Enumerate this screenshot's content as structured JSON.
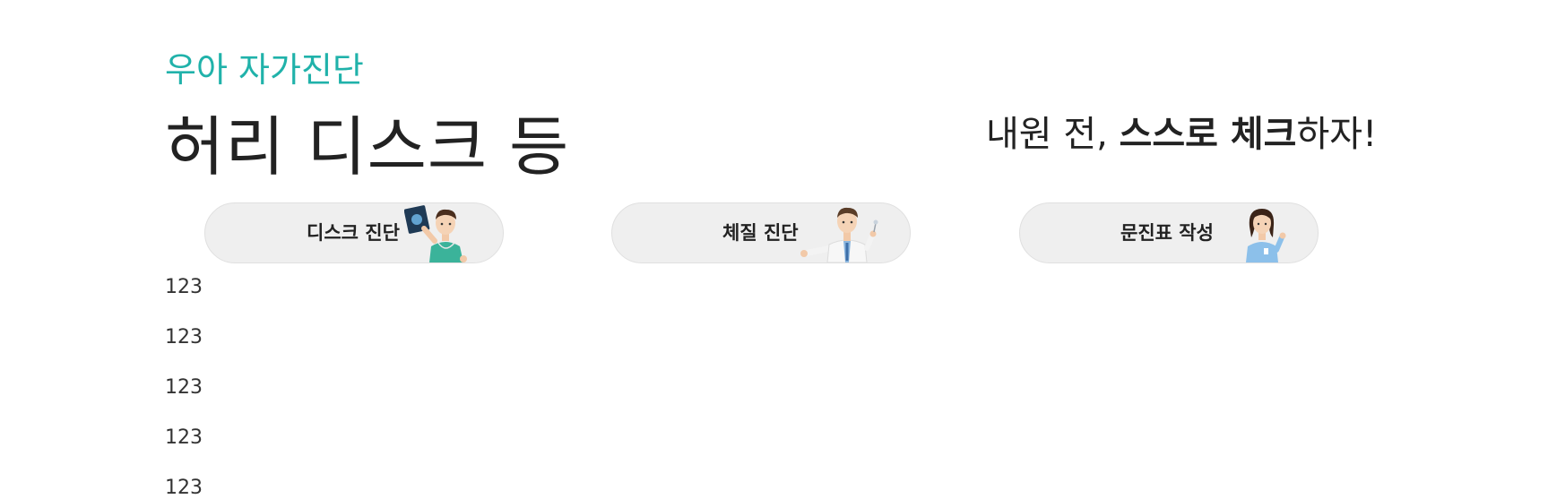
{
  "header": {
    "subtitle": "우아 자가진단",
    "title": "허리 디스크 등",
    "tagline": {
      "part1": "내원 전, ",
      "part2_bold": "스스로 체크",
      "part3": "하자!"
    }
  },
  "buttons": [
    {
      "label": "디스크 진단",
      "icon": "doctor-holding-xray-icon"
    },
    {
      "label": "체질 진단",
      "icon": "doctor-presenting-icon"
    },
    {
      "label": "문진표 작성",
      "icon": "nurse-pointing-icon"
    }
  ],
  "list": [
    "123",
    "123",
    "123",
    "123",
    "123"
  ],
  "colors": {
    "accent": "#20b2aa",
    "button_bg": "#efefef",
    "text": "#222222"
  }
}
